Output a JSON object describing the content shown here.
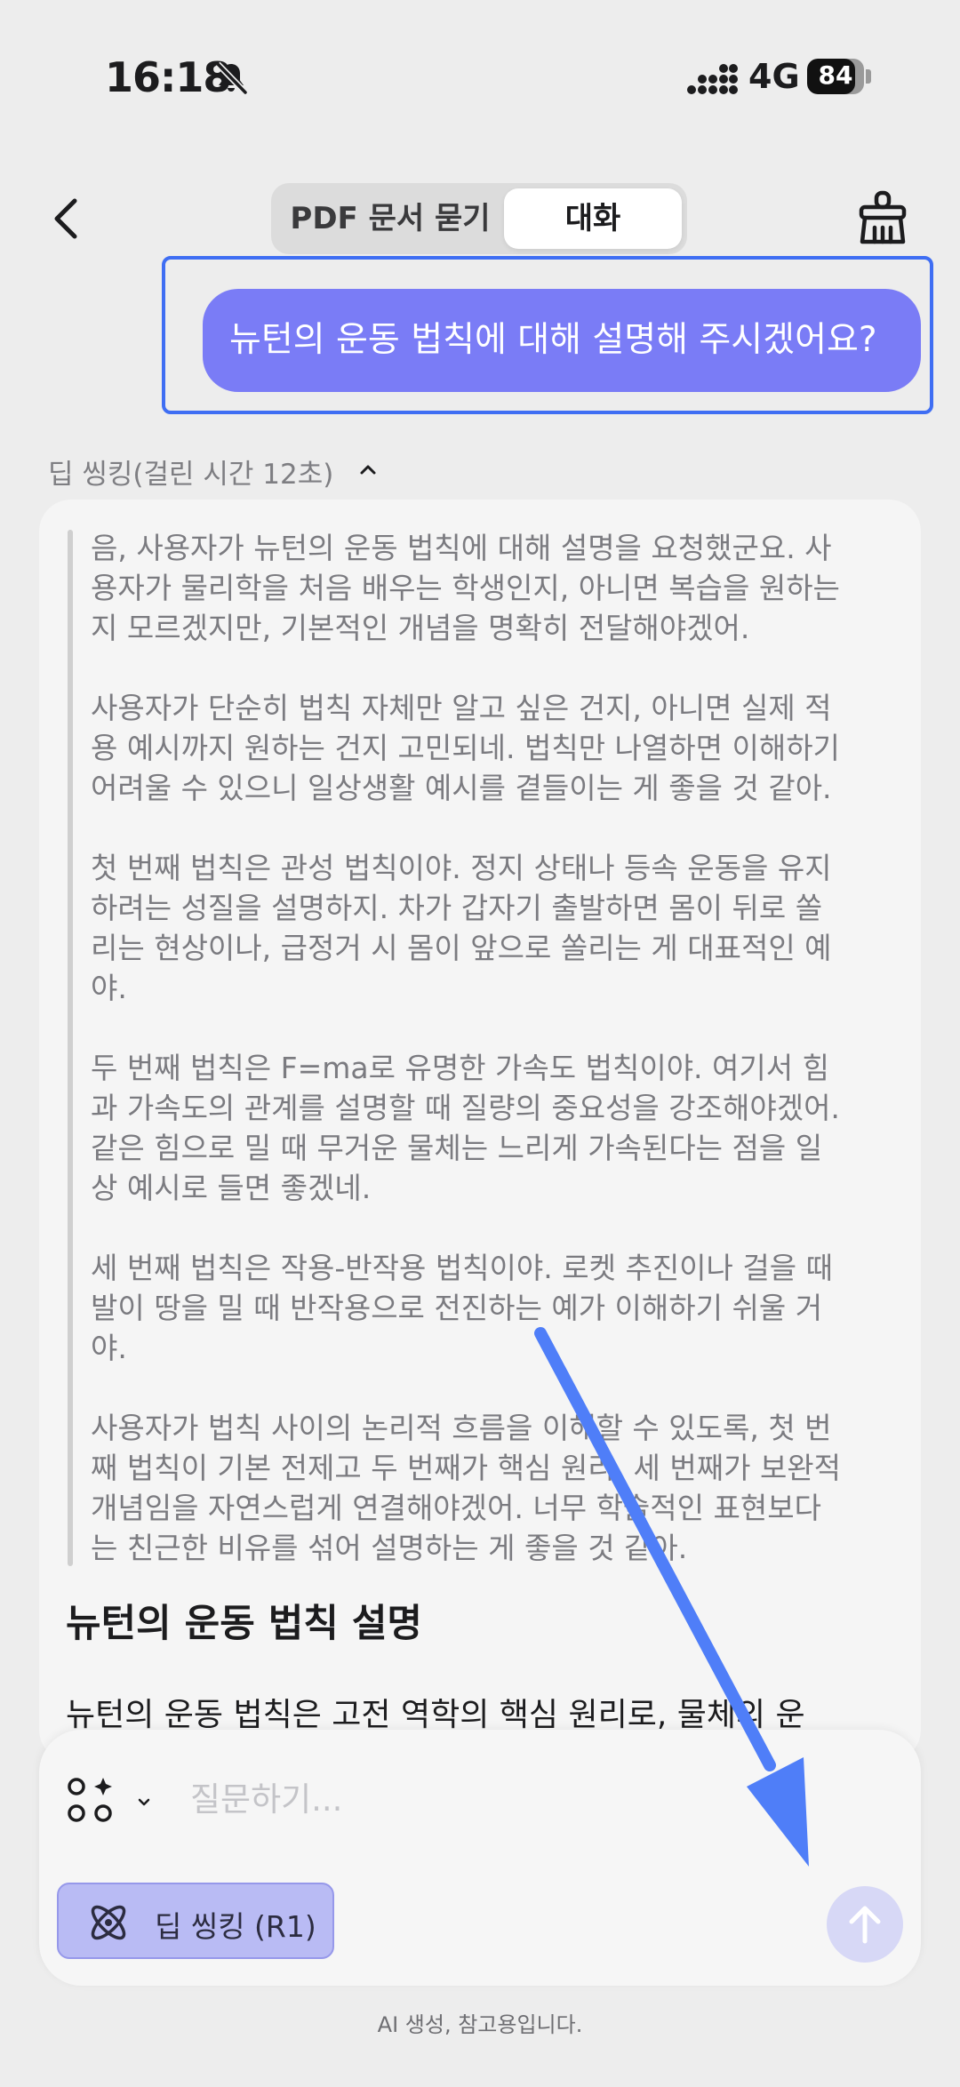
{
  "status_bar": {
    "time": "16:18",
    "network": "4G",
    "battery_level": 84,
    "battery_text": "84"
  },
  "header": {
    "tabs": [
      {
        "label": "PDF 문서 묻기",
        "selected": false
      },
      {
        "label": "대화",
        "selected": true
      }
    ]
  },
  "user_message": {
    "text": "뉴턴의 운동 법칙에 대해 설명해 주시겠어요?"
  },
  "thinking": {
    "header": "딥 씽킹(걸린 시간 12초)",
    "paragraphs": [
      "음, 사용자가 뉴턴의 운동 법칙에 대해 설명을 요청했군요. 사\n용자가 물리학을 처음 배우는 학생인지, 아니면 복습을 원하는\n지 모르겠지만, 기본적인 개념을 명확히 전달해야겠어.",
      "사용자가 단순히 법칙 자체만 알고 싶은 건지, 아니면 실제 적\n용 예시까지 원하는 건지 고민되네. 법칙만 나열하면 이해하기\n어려울 수 있으니 일상생활 예시를 곁들이는 게 좋을 것 같아.",
      "첫 번째 법칙은 관성 법칙이야. 정지 상태나 등속 운동을 유지\n하려는 성질을 설명하지. 차가 갑자기 출발하면 몸이 뒤로 쏠\n리는 현상이나, 급정거 시 몸이 앞으로 쏠리는 게 대표적인 예\n야.",
      "두 번째 법칙은 F=ma로 유명한 가속도 법칙이야. 여기서 힘\n과 가속도의 관계를 설명할 때 질량의 중요성을 강조해야겠어.\n같은 힘으로 밀 때 무거운 물체는 느리게 가속된다는 점을 일\n상 예시로 들면 좋겠네.",
      "세 번째 법칙은 작용-반작용 법칙이야. 로켓 추진이나 걸을 때\n발이 땅을 밀 때 반작용으로 전진하는 예가 이해하기 쉬울 거\n야.",
      "사용자가 법칙 사이의 논리적 흐름을 이해할 수 있도록, 첫 번\n째 법칙이 기본 전제고 두 번째가 핵심 원리, 세 번째가 보완적\n개념임을 자연스럽게 연결해야겠어. 너무 학술적인 표현보다\n는 친근한 비유를 섞어 설명하는 게 좋을 것 같아."
    ]
  },
  "answer": {
    "heading": "뉴턴의 운동 법칙 설명",
    "text": "뉴턴의 운동 법칙은 고전 역학의 핵심 원리로, 물체의 운"
  },
  "composer": {
    "placeholder": "질문하기...",
    "deepthink_label": "딥 씽킹 (R1)"
  },
  "disclaimer": "AI 생성, 참고용입니다.",
  "colors": {
    "accent": "#7a7cf6",
    "annotation": "#3f6ef3",
    "deepthink_bg": "#b9bbf4",
    "send_bg": "#d7d8f6"
  }
}
